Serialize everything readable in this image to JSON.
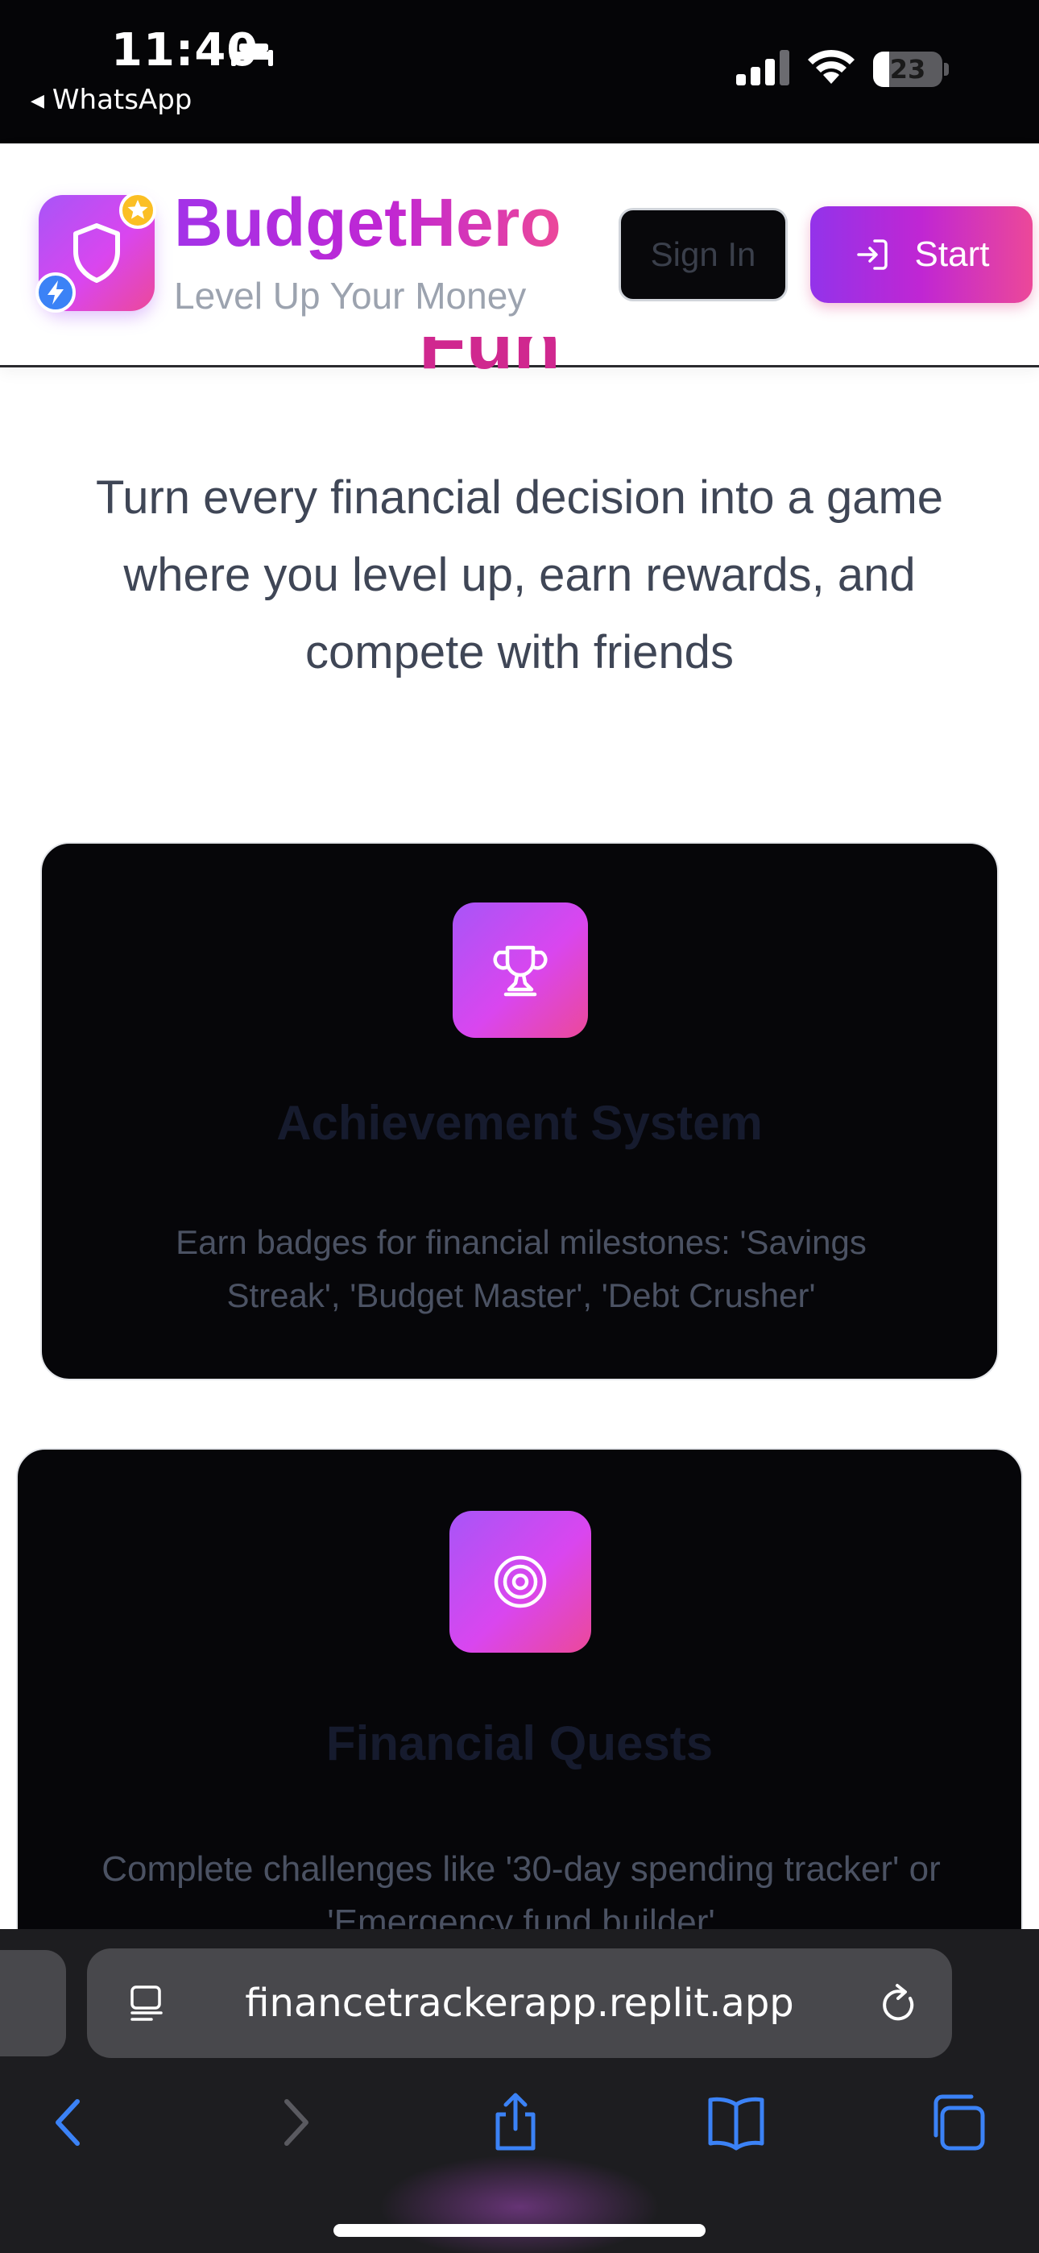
{
  "status_bar": {
    "time": "11:40",
    "back_app": "WhatsApp",
    "battery": "23",
    "battery_level": 0.23
  },
  "header": {
    "brand_title": "BudgetHero",
    "brand_subtitle": "Level Up Your Money",
    "signin_label": "Sign In",
    "start_label": "Start"
  },
  "hero": {
    "title_fragment": "Fun",
    "description": "Turn every financial decision into a game where you level up, earn rewards, and compete with friends"
  },
  "features": [
    {
      "icon": "trophy-icon",
      "title": "Achievement System",
      "description": "Earn badges for financial milestones: 'Savings Streak', 'Budget Master', 'Debt Crusher'"
    },
    {
      "icon": "target-icon",
      "title": "Financial Quests",
      "description": "Complete challenges like '30-day spending tracker' or 'Emergency fund builder'"
    }
  ],
  "browser": {
    "url": "financetrackerapp.replit.app"
  },
  "colors": {
    "brand_gradient_start": "#a855f7",
    "brand_gradient_end": "#ec4899",
    "card_background": "#060609",
    "safari_icon_blue": "#3b82f6"
  }
}
